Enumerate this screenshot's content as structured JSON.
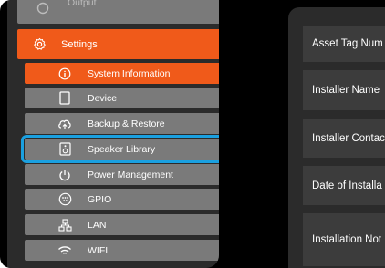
{
  "sidebar": {
    "output_label": "Output",
    "settings_label": "Settings",
    "items": [
      {
        "label": "System Information",
        "icon": "info-icon"
      },
      {
        "label": "Device",
        "icon": "device-icon"
      },
      {
        "label": "Backup & Restore",
        "icon": "cloud-upload-icon"
      },
      {
        "label": "Speaker Library",
        "icon": "speaker-icon"
      },
      {
        "label": "Power Management",
        "icon": "power-icon"
      },
      {
        "label": "GPIO",
        "icon": "gpio-icon"
      },
      {
        "label": "LAN",
        "icon": "lan-icon"
      },
      {
        "label": "WIFI",
        "icon": "wifi-icon"
      }
    ]
  },
  "form": {
    "fields": [
      {
        "label": "Asset Tag Num"
      },
      {
        "label": "Installer Name"
      },
      {
        "label": "Installer Contac"
      },
      {
        "label": "Date of Installa"
      },
      {
        "label": "Installation Not"
      }
    ]
  },
  "colors": {
    "accent": "#f05a1a",
    "item_bg": "#7a7a7a",
    "selection_outline": "#1aa0e0",
    "panel_bg": "#2b2b2b"
  }
}
